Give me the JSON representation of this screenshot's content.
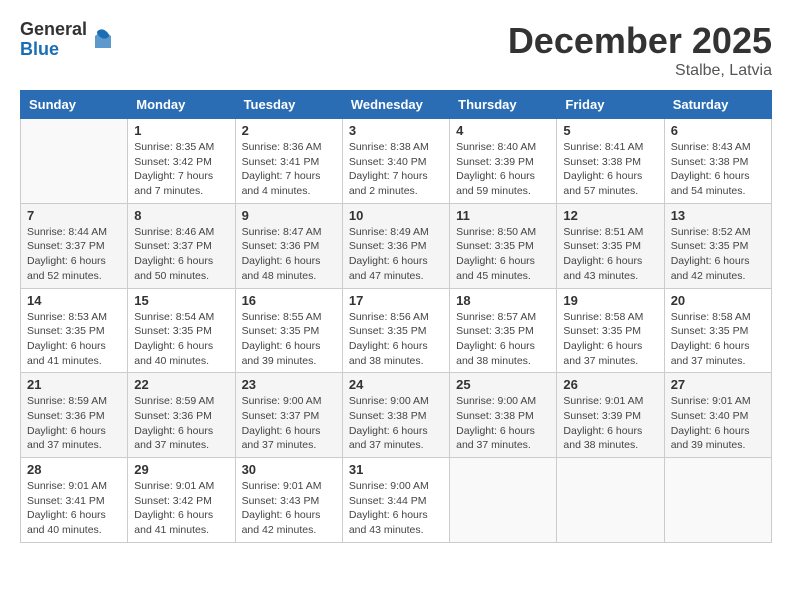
{
  "logo": {
    "general": "General",
    "blue": "Blue"
  },
  "title": "December 2025",
  "location": "Stalbe, Latvia",
  "days_of_week": [
    "Sunday",
    "Monday",
    "Tuesday",
    "Wednesday",
    "Thursday",
    "Friday",
    "Saturday"
  ],
  "weeks": [
    [
      {
        "day": "",
        "info": ""
      },
      {
        "day": "1",
        "info": "Sunrise: 8:35 AM\nSunset: 3:42 PM\nDaylight: 7 hours\nand 7 minutes."
      },
      {
        "day": "2",
        "info": "Sunrise: 8:36 AM\nSunset: 3:41 PM\nDaylight: 7 hours\nand 4 minutes."
      },
      {
        "day": "3",
        "info": "Sunrise: 8:38 AM\nSunset: 3:40 PM\nDaylight: 7 hours\nand 2 minutes."
      },
      {
        "day": "4",
        "info": "Sunrise: 8:40 AM\nSunset: 3:39 PM\nDaylight: 6 hours\nand 59 minutes."
      },
      {
        "day": "5",
        "info": "Sunrise: 8:41 AM\nSunset: 3:38 PM\nDaylight: 6 hours\nand 57 minutes."
      },
      {
        "day": "6",
        "info": "Sunrise: 8:43 AM\nSunset: 3:38 PM\nDaylight: 6 hours\nand 54 minutes."
      }
    ],
    [
      {
        "day": "7",
        "info": "Sunrise: 8:44 AM\nSunset: 3:37 PM\nDaylight: 6 hours\nand 52 minutes."
      },
      {
        "day": "8",
        "info": "Sunrise: 8:46 AM\nSunset: 3:37 PM\nDaylight: 6 hours\nand 50 minutes."
      },
      {
        "day": "9",
        "info": "Sunrise: 8:47 AM\nSunset: 3:36 PM\nDaylight: 6 hours\nand 48 minutes."
      },
      {
        "day": "10",
        "info": "Sunrise: 8:49 AM\nSunset: 3:36 PM\nDaylight: 6 hours\nand 47 minutes."
      },
      {
        "day": "11",
        "info": "Sunrise: 8:50 AM\nSunset: 3:35 PM\nDaylight: 6 hours\nand 45 minutes."
      },
      {
        "day": "12",
        "info": "Sunrise: 8:51 AM\nSunset: 3:35 PM\nDaylight: 6 hours\nand 43 minutes."
      },
      {
        "day": "13",
        "info": "Sunrise: 8:52 AM\nSunset: 3:35 PM\nDaylight: 6 hours\nand 42 minutes."
      }
    ],
    [
      {
        "day": "14",
        "info": "Sunrise: 8:53 AM\nSunset: 3:35 PM\nDaylight: 6 hours\nand 41 minutes."
      },
      {
        "day": "15",
        "info": "Sunrise: 8:54 AM\nSunset: 3:35 PM\nDaylight: 6 hours\nand 40 minutes."
      },
      {
        "day": "16",
        "info": "Sunrise: 8:55 AM\nSunset: 3:35 PM\nDaylight: 6 hours\nand 39 minutes."
      },
      {
        "day": "17",
        "info": "Sunrise: 8:56 AM\nSunset: 3:35 PM\nDaylight: 6 hours\nand 38 minutes."
      },
      {
        "day": "18",
        "info": "Sunrise: 8:57 AM\nSunset: 3:35 PM\nDaylight: 6 hours\nand 38 minutes."
      },
      {
        "day": "19",
        "info": "Sunrise: 8:58 AM\nSunset: 3:35 PM\nDaylight: 6 hours\nand 37 minutes."
      },
      {
        "day": "20",
        "info": "Sunrise: 8:58 AM\nSunset: 3:35 PM\nDaylight: 6 hours\nand 37 minutes."
      }
    ],
    [
      {
        "day": "21",
        "info": "Sunrise: 8:59 AM\nSunset: 3:36 PM\nDaylight: 6 hours\nand 37 minutes."
      },
      {
        "day": "22",
        "info": "Sunrise: 8:59 AM\nSunset: 3:36 PM\nDaylight: 6 hours\nand 37 minutes."
      },
      {
        "day": "23",
        "info": "Sunrise: 9:00 AM\nSunset: 3:37 PM\nDaylight: 6 hours\nand 37 minutes."
      },
      {
        "day": "24",
        "info": "Sunrise: 9:00 AM\nSunset: 3:38 PM\nDaylight: 6 hours\nand 37 minutes."
      },
      {
        "day": "25",
        "info": "Sunrise: 9:00 AM\nSunset: 3:38 PM\nDaylight: 6 hours\nand 37 minutes."
      },
      {
        "day": "26",
        "info": "Sunrise: 9:01 AM\nSunset: 3:39 PM\nDaylight: 6 hours\nand 38 minutes."
      },
      {
        "day": "27",
        "info": "Sunrise: 9:01 AM\nSunset: 3:40 PM\nDaylight: 6 hours\nand 39 minutes."
      }
    ],
    [
      {
        "day": "28",
        "info": "Sunrise: 9:01 AM\nSunset: 3:41 PM\nDaylight: 6 hours\nand 40 minutes."
      },
      {
        "day": "29",
        "info": "Sunrise: 9:01 AM\nSunset: 3:42 PM\nDaylight: 6 hours\nand 41 minutes."
      },
      {
        "day": "30",
        "info": "Sunrise: 9:01 AM\nSunset: 3:43 PM\nDaylight: 6 hours\nand 42 minutes."
      },
      {
        "day": "31",
        "info": "Sunrise: 9:00 AM\nSunset: 3:44 PM\nDaylight: 6 hours\nand 43 minutes."
      },
      {
        "day": "",
        "info": ""
      },
      {
        "day": "",
        "info": ""
      },
      {
        "day": "",
        "info": ""
      }
    ]
  ]
}
